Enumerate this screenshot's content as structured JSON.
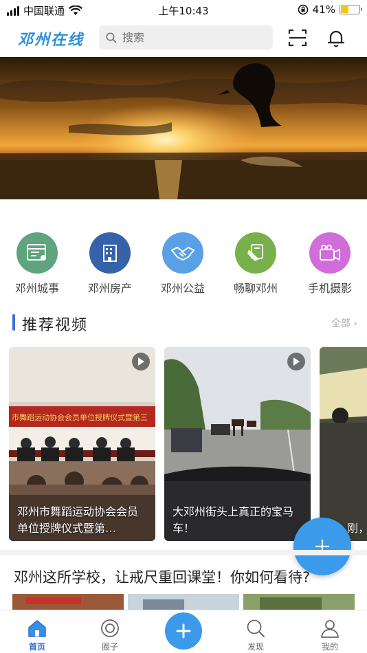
{
  "status_bar": {
    "carrier": "中国联通",
    "time": "上午10:43",
    "battery_percent": "41%",
    "battery_level": 0.41
  },
  "header": {
    "logo": "邓州在线",
    "search_placeholder": "搜索",
    "icons": [
      "scan-icon",
      "bell-icon"
    ]
  },
  "categories": [
    {
      "label": "邓州城事",
      "color": "#5fa37f",
      "icon": "newspaper-icon"
    },
    {
      "label": "邓州房产",
      "color": "#3562a8",
      "icon": "building-icon"
    },
    {
      "label": "邓州公益",
      "color": "#5aa0e6",
      "icon": "handshake-icon"
    },
    {
      "label": "畅聊邓州",
      "color": "#78b14a",
      "icon": "chat-icon"
    },
    {
      "label": "手机摄影",
      "color": "#cf6ed8",
      "icon": "camera-icon"
    }
  ],
  "video_section": {
    "title": "推荐视频",
    "more": "全部 ›"
  },
  "videos": [
    {
      "caption": "邓州市舞蹈运动协会会员单位授牌仪式暨第…"
    },
    {
      "caption": "大邓州街头上真正的宝马车！"
    },
    {
      "caption": "刚，"
    }
  ],
  "article": {
    "title": "邓州这所学校，让戒尺重回课堂！你如何看待?"
  },
  "tabbar": {
    "tabs": [
      {
        "label": "首页",
        "icon": "home-icon",
        "active": true
      },
      {
        "label": "圈子",
        "icon": "circle-icon",
        "active": false
      },
      {
        "label": "发现",
        "icon": "discover-search-icon",
        "active": false
      },
      {
        "label": "我的",
        "icon": "profile-icon",
        "active": false
      }
    ]
  }
}
